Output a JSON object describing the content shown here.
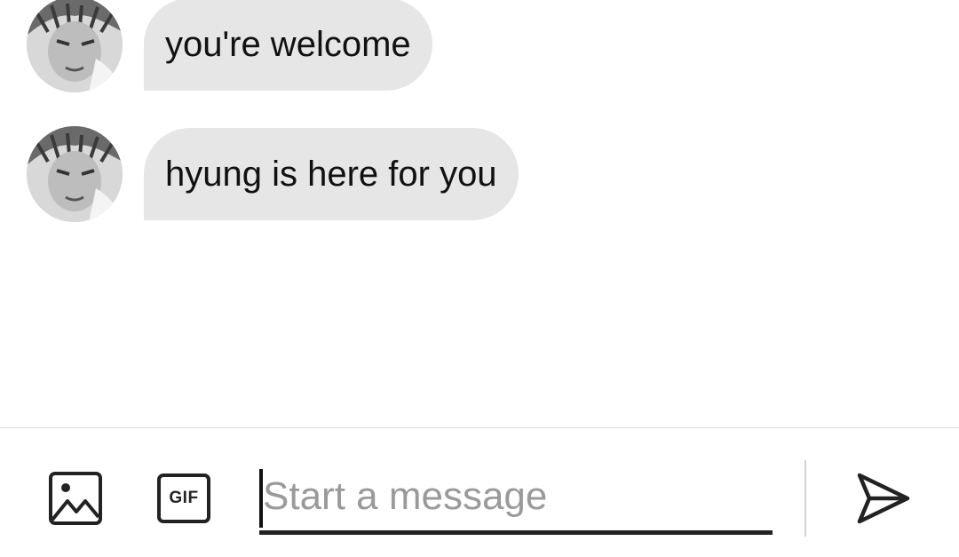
{
  "messages": [
    {
      "sender": "other",
      "text": "you're welcome"
    },
    {
      "sender": "other",
      "text": "hyung is here for you"
    }
  ],
  "composer": {
    "placeholder": "Start a message",
    "gif_label": "GIF",
    "icons": {
      "image": "image-icon",
      "gif": "gif-icon",
      "send": "send-icon"
    }
  },
  "colors": {
    "background": "#ffffff",
    "bubble": "#e6e6e6",
    "text": "#111111",
    "placeholder": "#9a9a9a",
    "divider": "#dcdcdc"
  }
}
